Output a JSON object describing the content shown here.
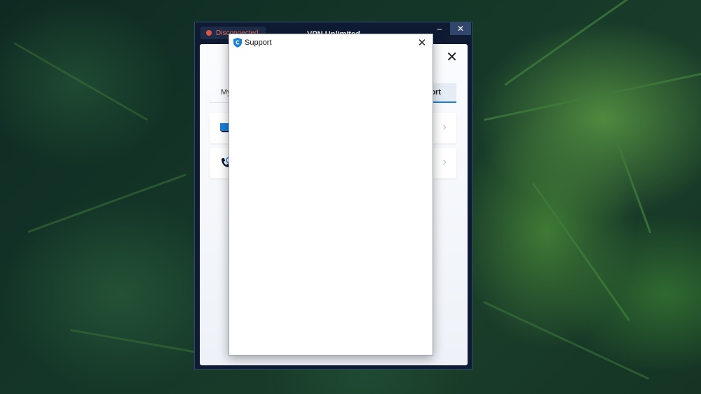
{
  "vpn_window": {
    "status": "Disconnected",
    "title": "VPN Unlimited",
    "minimize_glyph": "–",
    "close_glyph": "✕"
  },
  "panel": {
    "close_glyph": "✕",
    "tabs": [
      {
        "label": "My"
      },
      {
        "label": "Support",
        "visible_label": "ort",
        "active": true
      }
    ],
    "cards": [
      {
        "icon": "chat-icon"
      },
      {
        "icon": "phone-icon"
      }
    ],
    "chevron_glyph": "›"
  },
  "support_dialog": {
    "title": "Support",
    "icon": "shield-icon",
    "close_glyph": "✕"
  },
  "colors": {
    "window_bg": "#0e1b33",
    "accent": "#1a7fd6",
    "disconnected": "#e0574a"
  }
}
